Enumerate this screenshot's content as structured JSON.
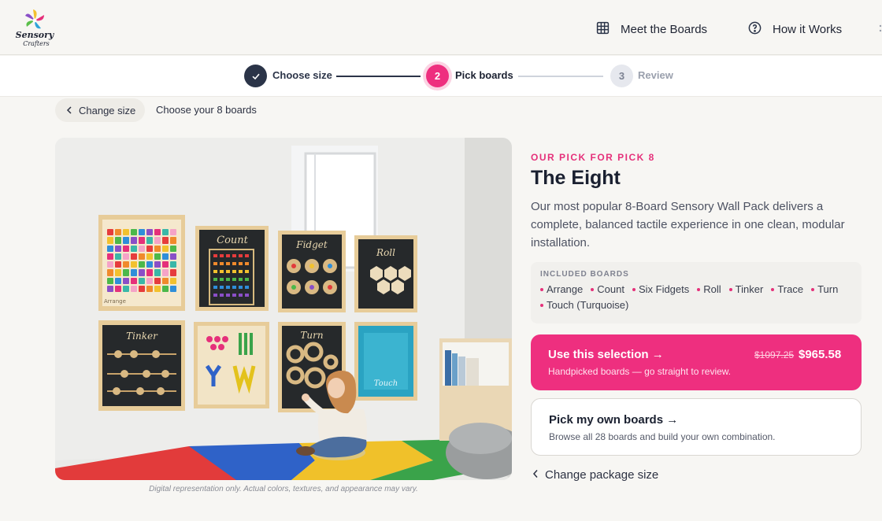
{
  "brand": {
    "logo_word_1": "Sensory",
    "logo_word_2": "Crafters"
  },
  "nav": {
    "items": [
      {
        "label": "Meet the Boards",
        "icon": "grid-icon"
      },
      {
        "label": "How it Works",
        "icon": "help-circle-icon"
      }
    ]
  },
  "stepper": {
    "steps": [
      {
        "number": "1",
        "label": "Choose size",
        "state": "complete"
      },
      {
        "number": "2",
        "label": "Pick boards",
        "state": "active"
      },
      {
        "number": "3",
        "label": "Review",
        "state": "upcoming"
      }
    ]
  },
  "breadcrumb": {
    "back_label": "Change size",
    "current": "Choose your 8 boards"
  },
  "hero": {
    "board_labels": [
      "Count",
      "Fidget",
      "Roll",
      "Tinker",
      "Turn",
      "Arrange",
      "Touch"
    ],
    "disclaimer": "Digital representation only. Actual colors, textures, and appearance may vary."
  },
  "pick": {
    "eyebrow": "OUR PICK FOR PICK 8",
    "title": "The Eight",
    "description": "Our most popular 8-Board Sensory Wall Pack delivers a complete, balanced tactile experience in one clean, modular installation."
  },
  "included": {
    "title": "INCLUDED BOARDS",
    "boards": [
      "Arrange",
      "Count",
      "Six Fidgets",
      "Roll",
      "Tinker",
      "Trace",
      "Turn",
      "Touch (Turquoise)"
    ]
  },
  "primary_cta": {
    "title": "Use this selection →",
    "subtitle": "Handpicked boards — go straight to review.",
    "old_price": "$1097.25",
    "price": "$965.58"
  },
  "secondary_cta": {
    "title": "Pick my own boards →",
    "subtitle": "Browse all 28 boards and build your own combination."
  },
  "back_link": {
    "label": "Change package size"
  },
  "colors": {
    "accent": "#ee2f7f",
    "navy": "#2b3448",
    "muted": "#9aa0ad"
  }
}
